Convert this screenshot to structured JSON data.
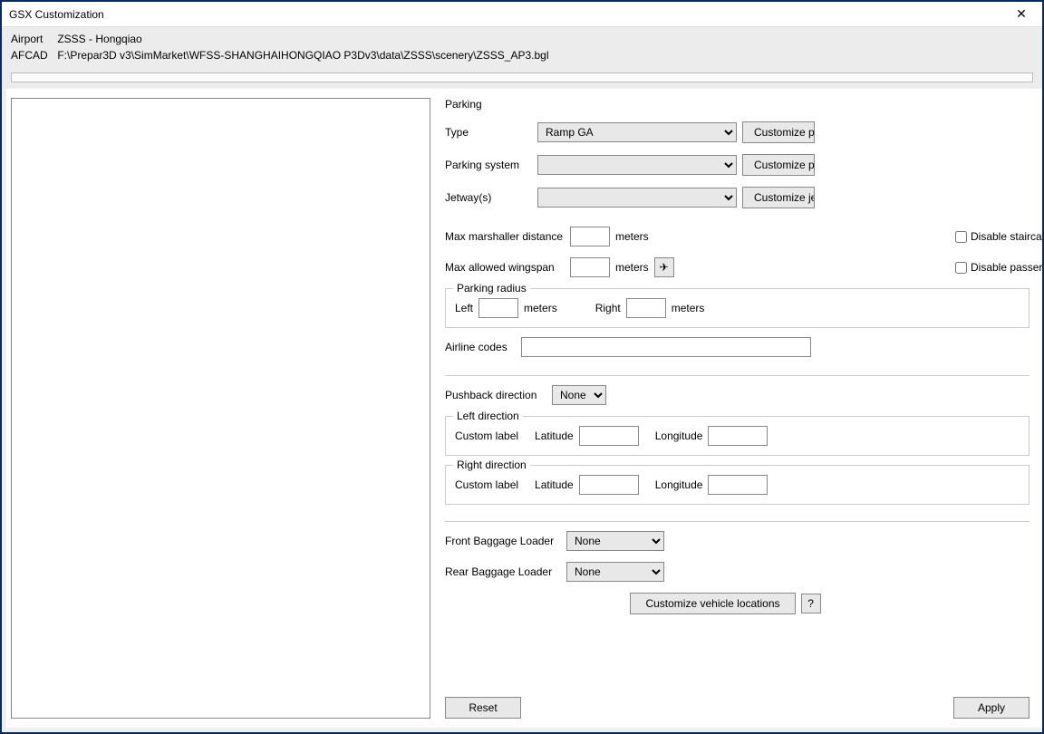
{
  "window": {
    "title": "GSX Customization"
  },
  "info": {
    "airport_label": "Airport",
    "airport_value": "ZSSS - Hongqiao",
    "afcad_label": "AFCAD",
    "afcad_value": "F:\\Prepar3D v3\\SimMarket\\WFSS-SHANGHAIHONGQIAO P3Dv3\\data\\ZSSS\\scenery\\ZSSS_AP3.bgl"
  },
  "parking": {
    "heading": "Parking",
    "type_label": "Type",
    "type_value": "Ramp GA",
    "parking_system_label": "Parking system",
    "parking_system_value": "",
    "jetway_label": "Jetway(s)",
    "jetway_value": "",
    "customize_p": "Customize p",
    "customize_jet": "Customize je",
    "max_marshaller_label": "Max marshaller distance",
    "max_wingspan_label": "Max allowed wingspan",
    "meters": "meters",
    "disable_staircase": "Disable stairca",
    "disable_passenger": "Disable passer",
    "parking_radius_legend": "Parking radius",
    "left_label": "Left",
    "right_label": "Right",
    "airline_codes_label": "Airline codes",
    "pushback_label": "Pushback direction",
    "pushback_value": "None",
    "left_dir_legend": "Left direction",
    "right_dir_legend": "Right direction",
    "custom_label": "Custom label",
    "latitude_label": "Latitude",
    "longitude_label": "Longitude",
    "front_loader_label": "Front Baggage Loader",
    "rear_loader_label": "Rear Baggage Loader",
    "loader_value": "None",
    "customize_vehicle": "Customize vehicle locations",
    "help": "?",
    "reset": "Reset",
    "apply": "Apply",
    "plane_icon": "✈"
  }
}
